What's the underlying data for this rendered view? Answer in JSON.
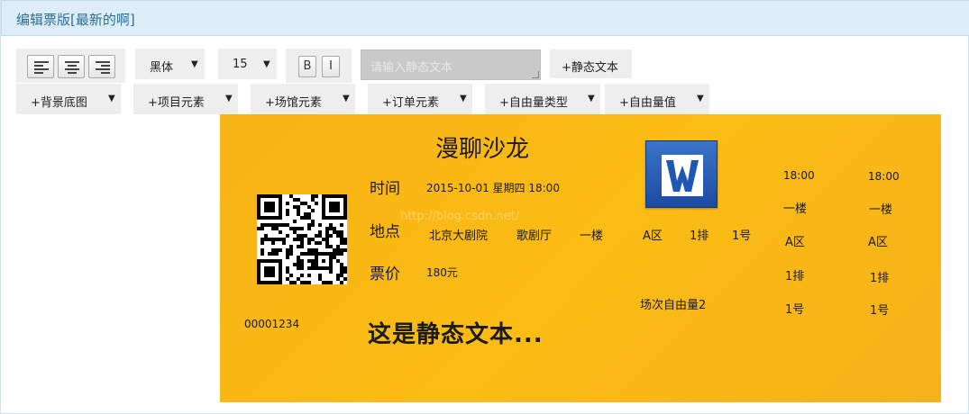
{
  "panel": {
    "title": "编辑票版[最新的啊]"
  },
  "toolbar": {
    "font_family": "黑体",
    "font_size": "15",
    "bold_label": "B",
    "italic_label": "I",
    "text_placeholder": "请输入静态文本",
    "add_static_text": "+静态文本",
    "dropdowns": [
      {
        "label": "+背景底图"
      },
      {
        "label": "+项目元素"
      },
      {
        "label": "+场馆元素"
      },
      {
        "label": "+订单元素"
      },
      {
        "label": "+自由量类型"
      },
      {
        "label": "+自由量值"
      }
    ],
    "caret": "▼"
  },
  "ticket": {
    "title": "漫聊沙龙",
    "time_label": "时间",
    "time_value": "2015-10-01  星期四  18:00",
    "place_label": "地点",
    "venue": "北京大剧院",
    "hall": "歌剧厅",
    "floor": "一楼",
    "area": "A区",
    "row": "1排",
    "seat": "1号",
    "price_label": "票价",
    "price_value": "180元",
    "free_var": "场次自由量2",
    "serial": "00001234",
    "static_text": "这是静态文本...",
    "watermark": "http://blog.csdn.net/",
    "stub1": {
      "time": "18:00",
      "floor": "一楼",
      "area": "A区",
      "row": "1排",
      "seat": "1号"
    },
    "stub2": {
      "time": "18:00",
      "floor": "一楼",
      "area": "A区",
      "row": "1排",
      "seat": "1号"
    }
  },
  "colors": {
    "ticket_bg": "#f8b317",
    "header_bg": "#dcedf7",
    "title_color": "#2b6f98",
    "logo_blue": "#2a5fb8"
  },
  "icons": [
    "align-left-icon",
    "align-center-icon",
    "align-right-icon",
    "qr-code-icon",
    "wps-writer-logo-icon"
  ]
}
